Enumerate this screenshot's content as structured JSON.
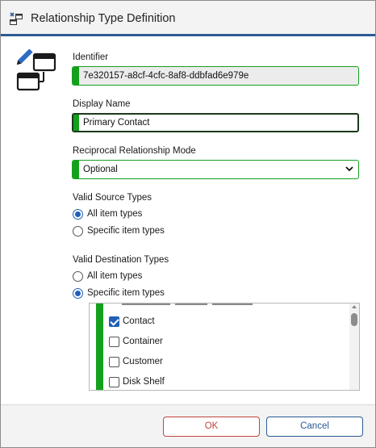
{
  "window": {
    "title": "Relationship Type Definition"
  },
  "identifier": {
    "label": "Identifier",
    "value": "7e320157-a8cf-4cfc-8af8-ddbfad6e979e"
  },
  "display_name": {
    "label": "Display Name",
    "value": "Primary Contact"
  },
  "reciprocal_mode": {
    "label": "Reciprocal Relationship Mode",
    "selected": "Optional"
  },
  "valid_source_types": {
    "label": "Valid Source Types",
    "options": [
      "All item types",
      "Specific item types"
    ],
    "selected_index": 0
  },
  "valid_destination_types": {
    "label": "Valid Destination Types",
    "options": [
      "All item types",
      "Specific item types"
    ],
    "selected_index": 1,
    "items": [
      {
        "label": "Contact",
        "checked": true
      },
      {
        "label": "Container",
        "checked": false
      },
      {
        "label": "Customer",
        "checked": false
      },
      {
        "label": "Disk Shelf",
        "checked": false
      }
    ]
  },
  "footer": {
    "ok_label": "OK",
    "cancel_label": "Cancel"
  },
  "icons": {
    "title": "relationship-window-icon",
    "header": "relationship-edit-icon",
    "dropdown": "chevron-down-icon"
  },
  "colors": {
    "accent_green": "#14a01c",
    "title_rule": "#2c5a94",
    "selection_blue": "#1f5fb8",
    "ok_border": "#c1443c"
  }
}
